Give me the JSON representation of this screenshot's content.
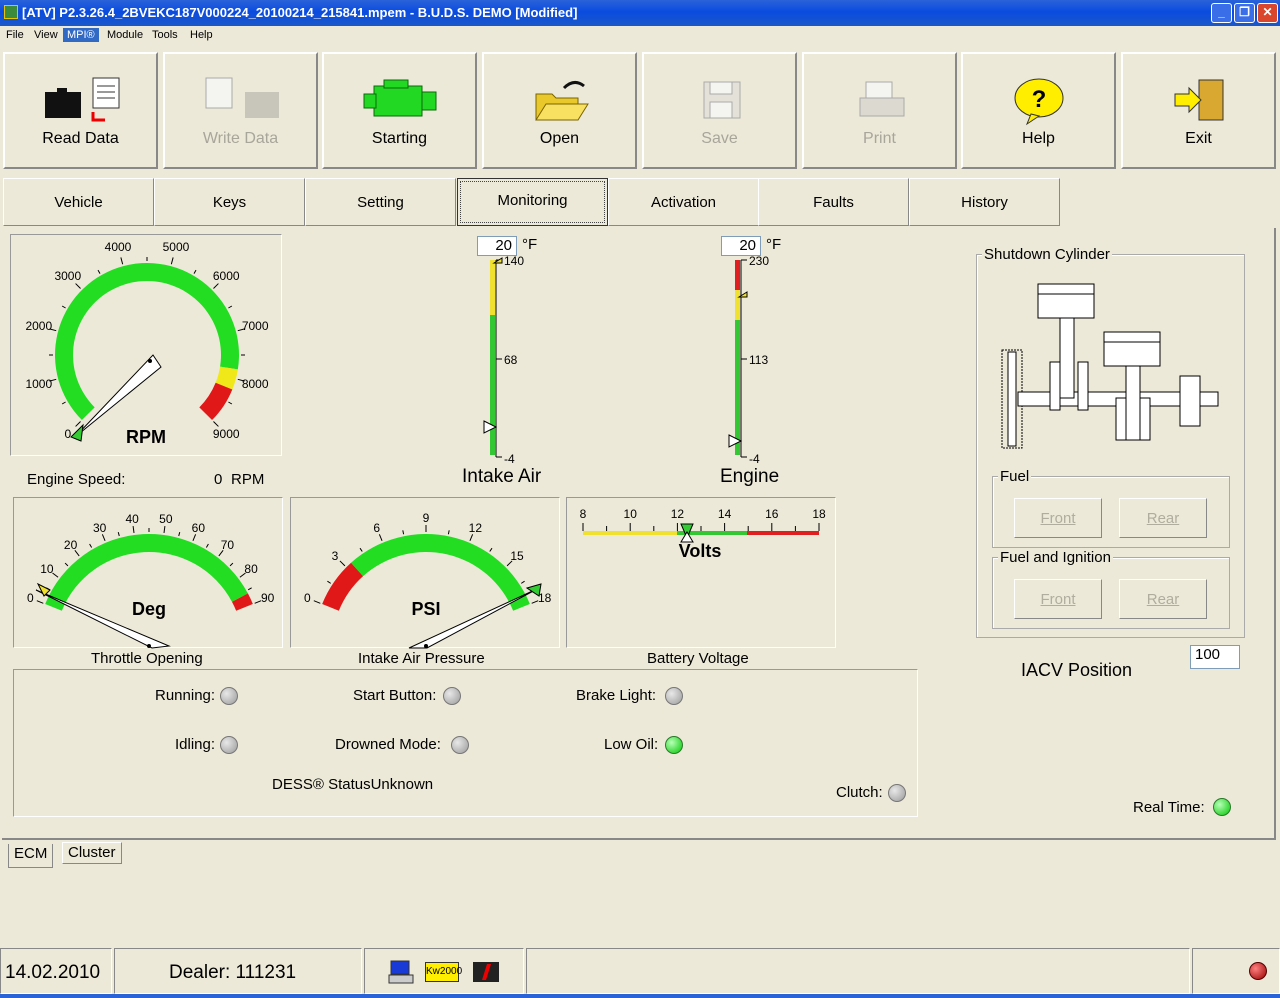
{
  "window": {
    "title": "[ATV] P2.3.26.4_2BVEKC187V000224_20100214_215841.mpem - B.U.D.S. DEMO [Modified]"
  },
  "menu": [
    "File",
    "View",
    "MPI®",
    "Module",
    "Tools",
    "Help"
  ],
  "toolbar": {
    "read": "Read Data",
    "write": "Write Data",
    "starting": "Starting",
    "open": "Open",
    "save": "Save",
    "print": "Print",
    "help": "Help",
    "exit": "Exit"
  },
  "tabs": [
    "Vehicle",
    "Keys",
    "Setting",
    "Monitoring",
    "Activation",
    "Faults",
    "History"
  ],
  "rpm_gauge": {
    "label": "RPM",
    "ticks": [
      "0",
      "1000",
      "2000",
      "3000",
      "4000",
      "5000",
      "6000",
      "7000",
      "8000",
      "9000"
    ],
    "value": 0
  },
  "engine_speed": {
    "label": "Engine Speed:",
    "value": "0",
    "unit": "RPM"
  },
  "intake_air": {
    "temp": "20",
    "unit": "°F",
    "max": "140",
    "mid": "68",
    "min": "-4",
    "label": "Intake Air"
  },
  "engine_temp": {
    "temp": "20",
    "unit": "°F",
    "max": "230",
    "mid": "113",
    "min": "-4",
    "label": "Engine"
  },
  "throttle": {
    "label": "Deg",
    "ticks": [
      "0",
      "10",
      "20",
      "30",
      "40",
      "50",
      "60",
      "70",
      "80",
      "90"
    ],
    "caption": "Throttle Opening",
    "value": 0
  },
  "pressure": {
    "label": "PSI",
    "ticks": [
      "0",
      "3",
      "6",
      "9",
      "12",
      "15",
      "18"
    ],
    "caption": "Intake Air Pressure",
    "value": 18
  },
  "battery": {
    "label": "Volts",
    "ticks": [
      "8",
      "10",
      "12",
      "14",
      "16",
      "18"
    ],
    "caption": "Battery Voltage",
    "value": 12.5
  },
  "status": {
    "running": "Running:",
    "start_button": "Start Button:",
    "brake_light": "Brake Light:",
    "idling": "Idling:",
    "drowned": "Drowned Mode:",
    "low_oil": "Low Oil:",
    "dess": "DESS® StatusUnknown",
    "clutch": "Clutch:"
  },
  "shutdown": {
    "title": "Shutdown Cylinder",
    "fuel": "Fuel",
    "fuel_ign": "Fuel and Ignition",
    "front": "Front",
    "rear": "Rear"
  },
  "iacv": {
    "label": "IACV Position",
    "value": "100"
  },
  "realtime": "Real Time:",
  "bottom_tabs": [
    "ECM",
    "Cluster"
  ],
  "statusbar": {
    "date": "14.02.2010",
    "dealer": "Dealer:  111231",
    "protocol": "Kw2000"
  }
}
